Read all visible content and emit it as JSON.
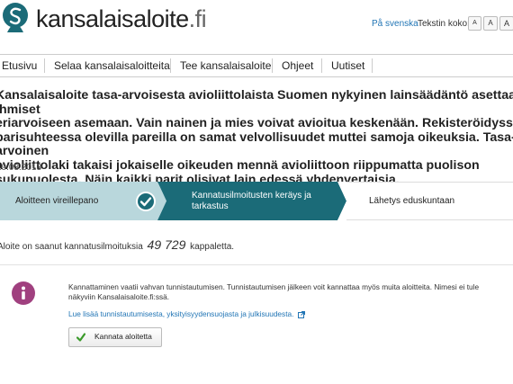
{
  "header": {
    "logo_prefix": "kansalais",
    "logo_middle": "aloite",
    "logo_suffix": ".fi",
    "language_link": "På svenska",
    "text_size_label": "Tekstin koko:",
    "text_size_buttons": [
      "A",
      "A",
      "A"
    ]
  },
  "nav": {
    "items": [
      "Etusivu",
      "Selaa kansalaisaloitteita",
      "Tee kansalaisaloite",
      "Ohjeet",
      "Uutiset"
    ]
  },
  "initiative": {
    "title_lines": [
      "Kansalaisaloite tasa-arvoisesta avioliittolaista Suomen nykyinen lainsäädäntö asettaa ihmiset",
      "eriarvoiseen asemaan. Vain nainen ja mies voivat avioitua keskenään. Rekisteröidyssä",
      "parisuhteessa olevilla pareilla on samat velvollisuudet muttei samoja oikeuksia. Tasa-arvoinen",
      "avioliittolaki takaisi jokaiselle oikeuden mennä avioliittoon riippumatta puolison",
      "sukupuolesta. Näin kaikki parit olisivat lain edessä yhdenvertaisia."
    ],
    "date": "19.03.2013"
  },
  "stepper": {
    "steps": [
      "Aloitteen vireillepano",
      "Kannatusilmoitusten keräys ja tarkastus",
      "Lähetys eduskuntaan"
    ],
    "active_line1": "Kannatusilmoitusten keräys ja",
    "active_line2": "tarkastus",
    "colors": {
      "done": "#b9d7dc",
      "active": "#1b6b78",
      "pending": "#ffffff"
    }
  },
  "support": {
    "prefix": "Aloite on saanut kannatusilmoituksia",
    "count": "49 729",
    "suffix": "kappaletta."
  },
  "info": {
    "text": "Kannattaminen vaatii vahvan tunnistautumisen. Tunnistautumisen jälkeen voit kannattaa myös muita aloitteita. Nimesi ei tule näkyviin Kansalaisaloite.fi:ssä.",
    "link": "Lue lisää tunnistautumisesta, yksityisyydensuojasta ja julkisuudesta.",
    "button_label": "Kannata aloitetta",
    "icon_color": "#a0407f"
  }
}
